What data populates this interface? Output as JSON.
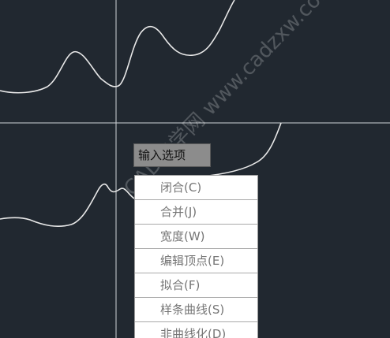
{
  "tooltip": {
    "label": "输入选项"
  },
  "menu": {
    "items": [
      {
        "label": "闭合(C)"
      },
      {
        "label": "合并(J)"
      },
      {
        "label": "宽度(W)"
      },
      {
        "label": "编辑顶点(E)"
      },
      {
        "label": "拟合(F)"
      },
      {
        "label": "样条曲线(S)"
      },
      {
        "label": "非曲线化(D)"
      }
    ]
  },
  "watermark": {
    "text": "CAD自学网 www.cadzxw.com"
  },
  "colors": {
    "background": "#212830",
    "crosshair": "#d0d4d8",
    "curve": "#e8e8e8",
    "menu_bg": "#ffffff",
    "menu_text": "#757575",
    "tooltip_bg": "#8c8c8c"
  }
}
